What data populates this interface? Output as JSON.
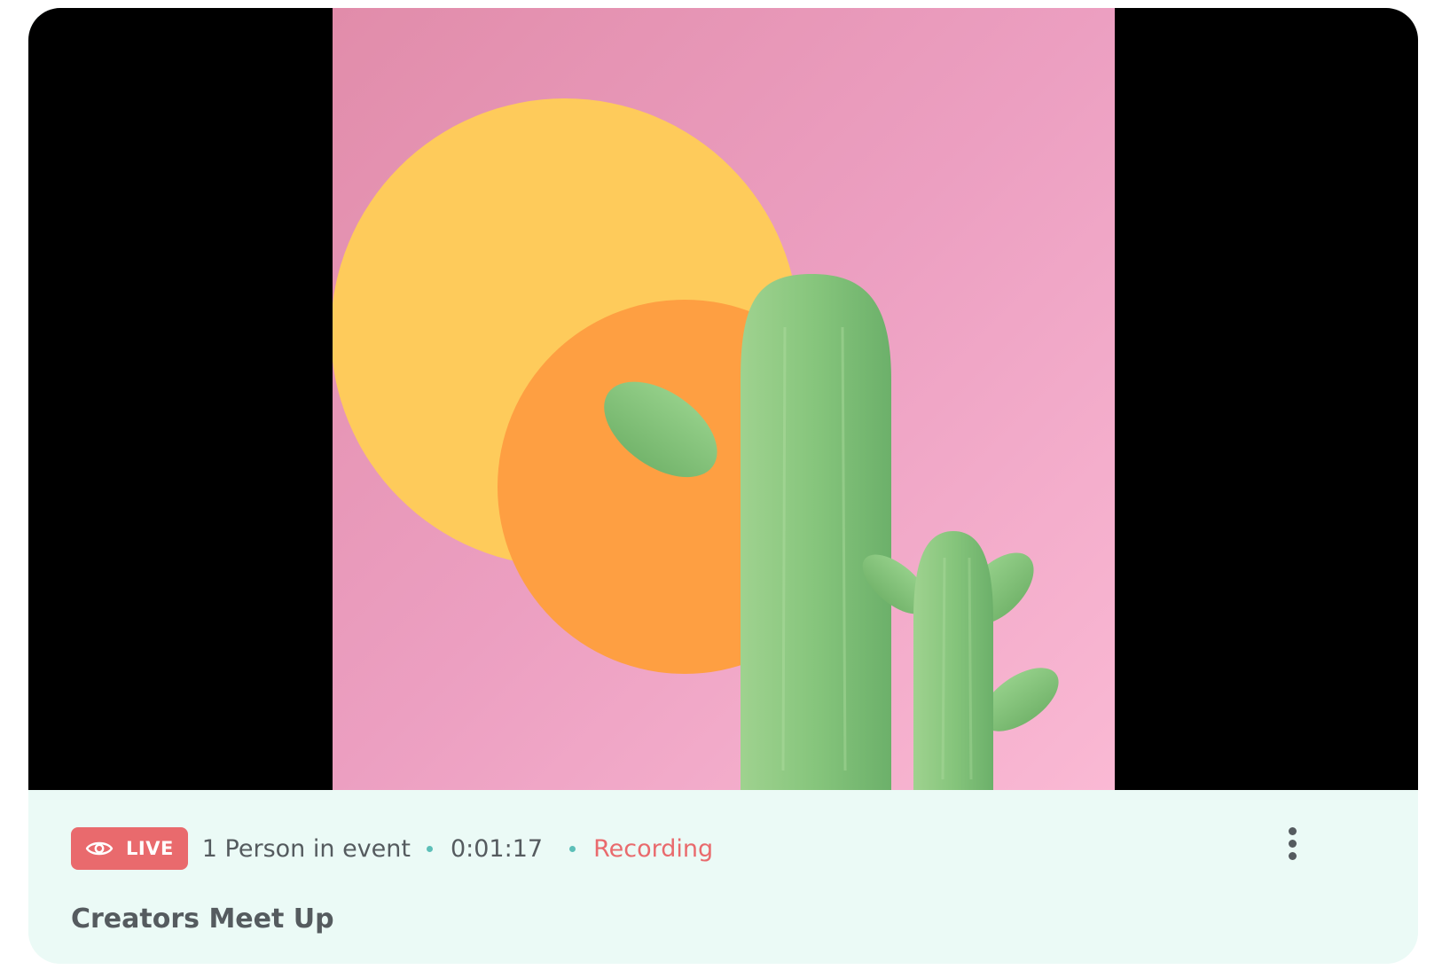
{
  "stream": {
    "live_label": "LIVE",
    "participants_text": "1 Person in event",
    "elapsed_time": "0:01:17",
    "recording_label": "Recording",
    "title": "Creators Meet Up"
  },
  "icons": {
    "live": "eye-icon",
    "menu": "more-vertical-icon"
  },
  "colors": {
    "live_badge": "#e96a6d",
    "recording_text": "#e96a6d",
    "separator_dot": "#5cbfb8",
    "info_panel_bg": "#ebfaf6",
    "text_primary": "#555b5f",
    "artwork_bg": "#ee9ec2",
    "sun_yellow": "#fecb5b",
    "sun_orange": "#fe9f42",
    "cactus_green": "#86c57c"
  }
}
